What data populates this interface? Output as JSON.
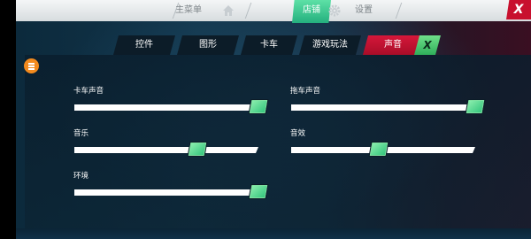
{
  "nav": {
    "main_menu": "主菜单",
    "store": "店铺",
    "settings": "设置",
    "close": "X"
  },
  "tabs": [
    {
      "label": "控件"
    },
    {
      "label": "图形"
    },
    {
      "label": "卡车"
    },
    {
      "label": "游戏玩法"
    },
    {
      "label": "声音",
      "selected": true
    }
  ],
  "tabs_close": "X",
  "sliders": [
    {
      "label": "卡车声音",
      "level": 1.0
    },
    {
      "label": "拖车声音",
      "level": 1.0
    },
    {
      "label": "音乐",
      "level": 0.7
    },
    {
      "label": "音效",
      "level": 0.5
    },
    {
      "label": "环境",
      "level": 1.0
    }
  ],
  "icons": [
    "home-icon",
    "gear-icon",
    "menu-icon"
  ],
  "colors": {
    "accent_red": "#c8102e",
    "accent_green": "#2fc27a",
    "store_tab": "#24b07e",
    "menu_button": "#f28a1e"
  }
}
